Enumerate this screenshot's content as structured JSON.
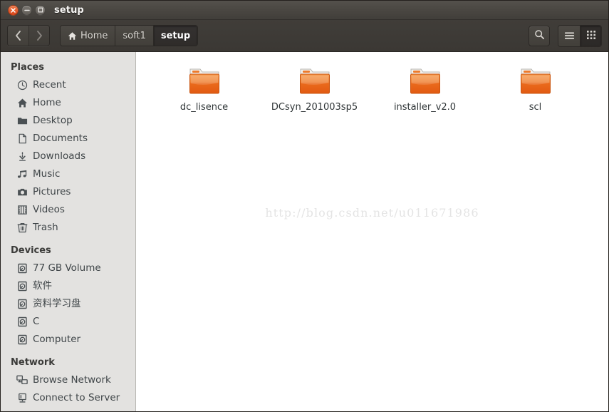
{
  "window": {
    "title": "setup",
    "controls": [
      {
        "name": "close",
        "icon": "close-icon",
        "glyph": "×"
      },
      {
        "name": "minimize",
        "icon": "minimize-icon",
        "glyph": "−"
      },
      {
        "name": "maximize",
        "icon": "maximize-icon",
        "glyph": "□"
      }
    ]
  },
  "toolbar": {
    "back_label": "Back",
    "forward_label": "Forward",
    "back_icon": "chevron-left-icon",
    "forward_icon": "chevron-right-icon",
    "breadcrumbs": [
      {
        "label": "Home",
        "icon": "home-icon",
        "active": false
      },
      {
        "label": "soft1",
        "icon": "",
        "active": false
      },
      {
        "label": "setup",
        "icon": "",
        "active": true
      }
    ],
    "search_icon": "search-icon",
    "search_label": "Search",
    "view_list_icon": "list-view-icon",
    "view_grid_icon": "grid-view-icon",
    "view_active": "grid"
  },
  "sidebar": {
    "sections": [
      {
        "title": "Places",
        "items": [
          {
            "label": "Recent",
            "icon": "clock-icon"
          },
          {
            "label": "Home",
            "icon": "home-icon"
          },
          {
            "label": "Desktop",
            "icon": "folder-icon"
          },
          {
            "label": "Documents",
            "icon": "document-icon"
          },
          {
            "label": "Downloads",
            "icon": "download-icon"
          },
          {
            "label": "Music",
            "icon": "music-icon"
          },
          {
            "label": "Pictures",
            "icon": "camera-icon"
          },
          {
            "label": "Videos",
            "icon": "film-icon"
          },
          {
            "label": "Trash",
            "icon": "trash-icon"
          }
        ]
      },
      {
        "title": "Devices",
        "items": [
          {
            "label": "77 GB Volume",
            "icon": "drive-icon"
          },
          {
            "label": "软件",
            "icon": "drive-icon"
          },
          {
            "label": "资料学习盘",
            "icon": "drive-icon"
          },
          {
            "label": "C",
            "icon": "drive-icon"
          },
          {
            "label": "Computer",
            "icon": "drive-icon"
          }
        ]
      },
      {
        "title": "Network",
        "items": [
          {
            "label": "Browse Network",
            "icon": "network-icon"
          },
          {
            "label": "Connect to Server",
            "icon": "server-icon"
          }
        ]
      }
    ]
  },
  "main": {
    "files": [
      {
        "name": "dc_lisence",
        "type": "folder",
        "icon": "folder-icon"
      },
      {
        "name": "DCsyn_201003sp5",
        "type": "folder",
        "icon": "folder-icon"
      },
      {
        "name": "installer_v2.0",
        "type": "folder",
        "icon": "folder-icon"
      },
      {
        "name": "scl",
        "type": "folder",
        "icon": "folder-icon"
      }
    ],
    "watermark": "http://blog.csdn.net/u011671986"
  },
  "colors": {
    "titlebar": "#4a4742",
    "toolbar": "#3d3a36",
    "sidebar": "#e3e2e0",
    "main": "#ffffff",
    "folder": "#e8661c",
    "text": "#2e3436",
    "close_button": "#e0521e"
  }
}
